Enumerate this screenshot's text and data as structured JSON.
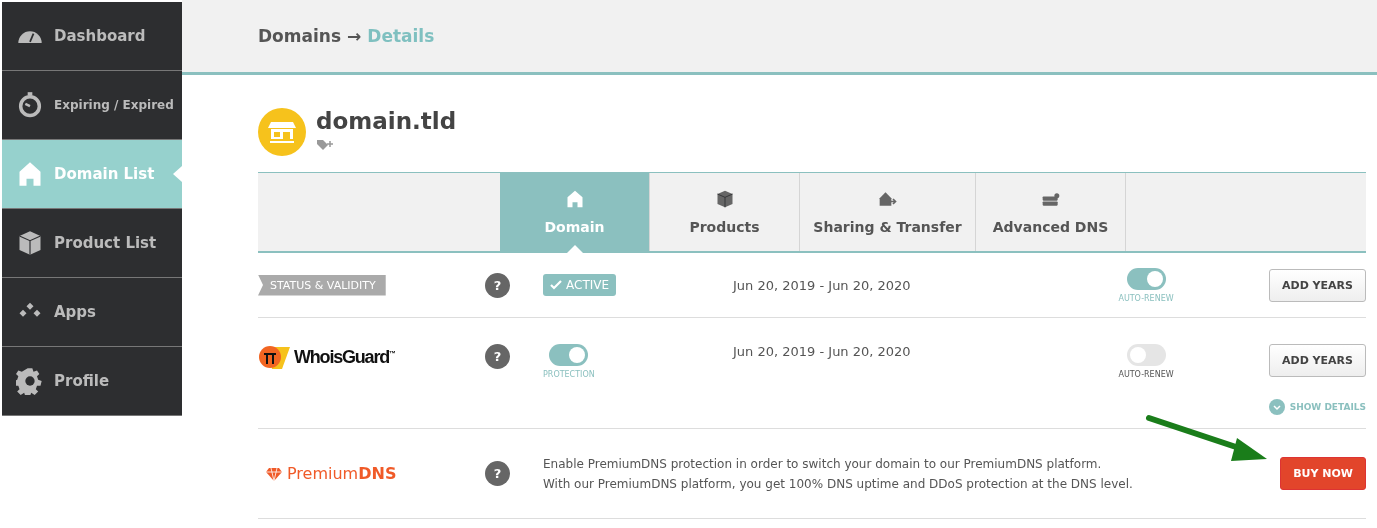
{
  "sidebar": {
    "items": [
      {
        "label": "Dashboard",
        "selected": false
      },
      {
        "label": "Expiring / Expired",
        "selected": false
      },
      {
        "label": "Domain List",
        "selected": true
      },
      {
        "label": "Product List",
        "selected": false
      },
      {
        "label": "Apps",
        "selected": false
      },
      {
        "label": "Profile",
        "selected": false
      }
    ]
  },
  "breadcrumb": {
    "items": [
      {
        "label": "Domains",
        "selected": false
      },
      {
        "label": "Details",
        "selected": true
      }
    ],
    "separator": "→"
  },
  "domain": {
    "name": "domain.tld"
  },
  "tabs": [
    {
      "label": "Domain",
      "selected": true
    },
    {
      "label": "Products",
      "selected": false
    },
    {
      "label": "Sharing & Transfer",
      "selected": false
    },
    {
      "label": "Advanced DNS",
      "selected": false
    }
  ],
  "rows": [
    {
      "kind": "status",
      "title": "STATUS & VALIDITY",
      "help": "?",
      "middle": {
        "kind": "badge",
        "text": "ACTIVE"
      },
      "dates": "Jun 20, 2019 - Jun 20, 2020",
      "renew": {
        "on": true,
        "label": "AUTO-RENEW"
      },
      "button": {
        "label": "ADD YEARS",
        "kind": "default"
      }
    },
    {
      "kind": "whoisguard",
      "title": "WhoisGuard$^{™}$",
      "help": "?",
      "middle": {
        "kind": "toggle",
        "on": true,
        "label": "PROTECTION"
      },
      "dates": "Jun 20, 2019 - Jun 20, 2020",
      "renew": {
        "on": false,
        "label": "AUTO-RENEW"
      },
      "button": {
        "label": "ADD YEARS",
        "kind": "default"
      },
      "details_link": "SHOW DETAILS"
    },
    {
      "kind": "premiumdns",
      "title": "Premium**DNS**",
      "help": "?",
      "middle": {
        "kind": "text",
        "lines": [
          "Enable PremiumDNS protection in order to switch your domain to our PremiumDNS platform.",
          "With our PremiumDNS platform, you get 100% DNS uptime and DDoS protection at the DNS level."
        ]
      },
      "button": {
        "label": "BUY NOW",
        "kind": "primary"
      }
    }
  ]
}
